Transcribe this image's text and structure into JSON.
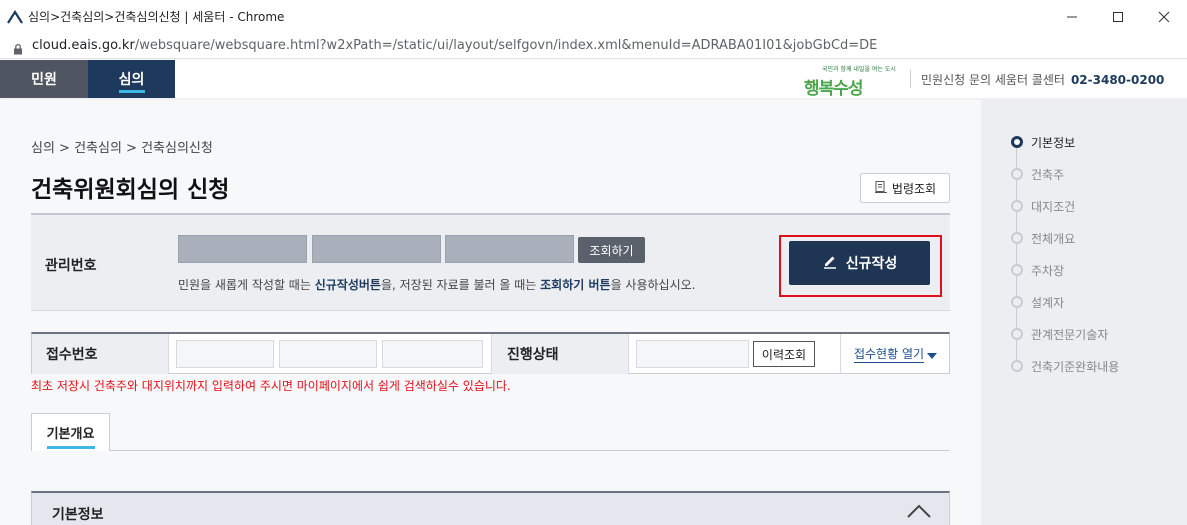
{
  "window": {
    "title": "심의>건축심의>건축심의신청 | 세움터 - Chrome",
    "controls": [
      "minimize-icon",
      "maximize-icon",
      "close-icon"
    ]
  },
  "address": {
    "host": "cloud.eais.go.kr",
    "path": "/websquare/websquare.html?w2xPath=/static/ui/layout/selfgovn/index.xml&menuId=ADRABA01I01&jobGbCd=DE"
  },
  "topnav": {
    "tabs": [
      {
        "label": "민원",
        "active": false
      },
      {
        "label": "심의",
        "active": true
      }
    ],
    "brand_slogan": "국민과 함께 내일을 여는 도시",
    "brand_logo_a": "행복",
    "brand_logo_b": "수성",
    "links": "민원신청 문의 세움터 콜센터",
    "phone": "02-3480-0200"
  },
  "breadcrumb": "심의  >  건축심의  >  건축심의신청",
  "page_title": "건축위원회심의 신청",
  "law_button": "법령조회",
  "mgmt": {
    "label": "관리번호",
    "fields": [
      "",
      "",
      ""
    ],
    "lookup_button": "조회하기",
    "help_pre": "민원을 새롭게 작성할 때는 ",
    "help_b1": "신규작성버튼",
    "help_mid": "을, 저장된 자료를 불러 올 때는 ",
    "help_b2": "조회하기 버튼",
    "help_post": "을 사용하십시오.",
    "new_button": "신규작성"
  },
  "receipt": {
    "label": "접수번호",
    "fields": [
      "",
      "",
      ""
    ],
    "status_label": "진행상태",
    "status_value": "",
    "history_button": "이력조회",
    "status_link": "접수현황 열기"
  },
  "notice": "최초 저장시 건축주와 대지위치까지 입력하여 주시면 마이페이지에서 쉽게 검색하실수 있습니다.",
  "subtab": "기본개요",
  "section": {
    "title": "기본정보",
    "expanded": true
  },
  "sidebar": {
    "items": [
      {
        "label": "기본정보",
        "active": true
      },
      {
        "label": "건축주",
        "active": false
      },
      {
        "label": "대지조건",
        "active": false
      },
      {
        "label": "전체개요",
        "active": false
      },
      {
        "label": "주차장",
        "active": false
      },
      {
        "label": "설계자",
        "active": false
      },
      {
        "label": "관계전문기술자",
        "active": false
      },
      {
        "label": "건축기준완화내용",
        "active": false
      }
    ]
  },
  "colors": {
    "navy": "#1d3a5c",
    "accent": "#3fb7e6",
    "highlight": "#e0101a"
  }
}
